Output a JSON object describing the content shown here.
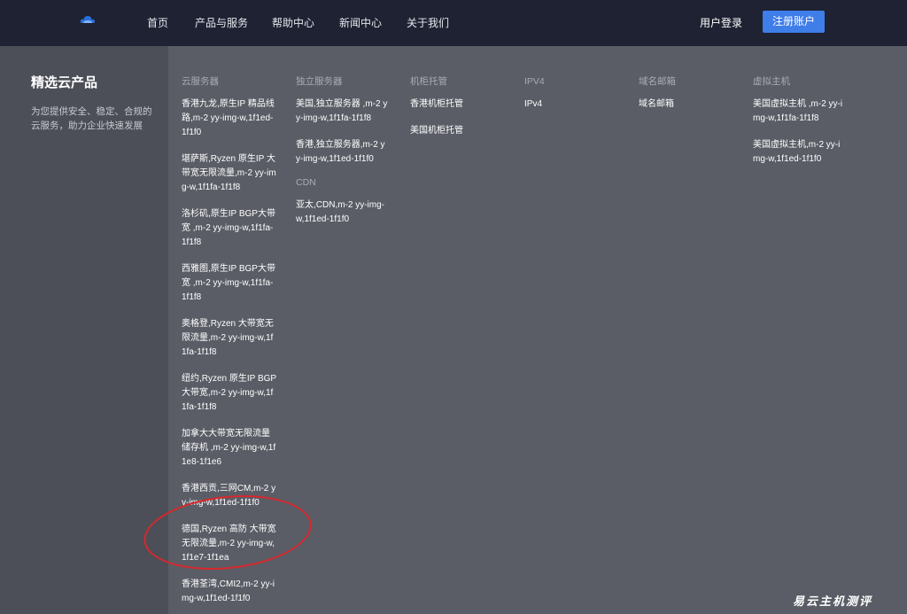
{
  "header": {
    "nav": [
      "首页",
      "产品与服务",
      "帮助中心",
      "新闻中心",
      "关于我们"
    ],
    "login": "用户登录",
    "register": "注册账户"
  },
  "sidebar": {
    "title": "精选云产品",
    "desc": "为您提供安全、稳定、合规的云服务，助力企业快速发展"
  },
  "columns": [
    {
      "head": "云服务器",
      "items": [
        "香港九龙,原生IP 精品线路,m-2 yy-img-w,1f1ed-1f1f0",
        "堪萨斯,Ryzen 原生IP 大带宽无限流量,m-2 yy-img-w,1f1fa-1f1f8",
        "洛杉矶,原生IP BGP大带宽 ,m-2 yy-img-w,1f1fa-1f1f8",
        "西雅图,原生IP BGP大带宽 ,m-2 yy-img-w,1f1fa-1f1f8",
        "奥格登,Ryzen 大带宽无限流量,m-2 yy-img-w,1f1fa-1f1f8",
        "纽约,Ryzen 原生IP BGP大带宽,m-2 yy-img-w,1f1fa-1f1f8",
        "加拿大大带宽无限流量储存机 ,m-2 yy-img-w,1f1e8-1f1e6",
        "香港西贡,三网CM,m-2 yy-img-w,1f1ed-1f1f0",
        "德国,Ryzen 高防 大带宽无限流量,m-2 yy-img-w,1f1e7-1f1ea",
        "香港荃湾,CMI2,m-2 yy-img-w,1f1ed-1f1f0"
      ]
    },
    {
      "head": "独立服务器",
      "items": [
        "美国,独立服务器 ,m-2 yy-img-w,1f1fa-1f1f8",
        "香港,独立服务器,m-2 yy-img-w,1f1ed-1f1f0"
      ],
      "sub_head": "CDN",
      "sub_items": [
        "亚太,CDN,m-2 yy-img-w,1f1ed-1f1f0"
      ]
    },
    {
      "head": "机柜托管",
      "items": [
        "香港机柜托管",
        "美国机柜托管"
      ]
    },
    {
      "head": "IPV4",
      "items": [
        "IPv4"
      ]
    },
    {
      "head": "域名邮箱",
      "items": [
        "域名邮箱"
      ]
    },
    {
      "head": "虚拟主机",
      "items": [
        "美国虚拟主机 ,m-2 yy-img-w,1f1fa-1f1f8",
        "美国虚拟主机,m-2 yy-img-w,1f1ed-1f1f0"
      ]
    }
  ],
  "watermark": "易云主机测评",
  "colors": {
    "header_bg": "#1e2232",
    "register_btn": "#3f7de8",
    "panel_bg": "#5a5d66",
    "highlight_circle": "#d9272c"
  }
}
